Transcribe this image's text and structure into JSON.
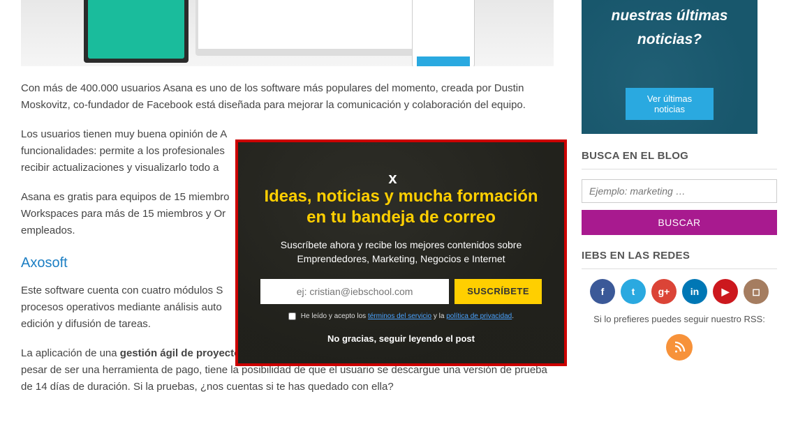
{
  "article": {
    "p1": "Con más de 400.000 usuarios Asana es uno de los software más populares del momento,  creada por Dustin Moskovitz, co-fundador de Facebook está diseñada para mejorar la comunicación y colaboración del equipo.",
    "p2": "Los usuarios tienen muy buena opinión de A",
    "p2b": "funcionalidades: permite a los profesionales",
    "p2c": "recibir actualizaciones y visualizarlo todo a",
    "p3a": "Asana es gratis para equipos de 15 miembro",
    "p3b": "Workspaces para más de 15 miembros y Or",
    "p3c": "empleados.",
    "h_axo": "Axosoft",
    "p4a": "Este software cuenta con cuatro módulos  S",
    "p4b": "procesos operativos mediante análisis auto",
    "p4c": "edición y difusión de tareas.",
    "p5_pre": "La aplicación de una ",
    "p5_bold": "gestión ágil de proyectos",
    "p5_post": " es sencillo a través de todas las posibilidades que nos oferta, a pesar de ser una herramienta de pago, tiene la posibilidad de que el usuario se descargue una versión de prueba de 14 días de duración. Si la pruebas, ¿nos cuentas si te has quedado con ella?"
  },
  "sidebar": {
    "news_q": "nuestras últimas noticias?",
    "news_btn": "Ver últimas noticias",
    "search_h": "BUSCA EN EL BLOG",
    "search_ph": "Ejemplo: marketing …",
    "search_btn": "BUSCAR",
    "social_h": "IEBS EN LAS REDES",
    "rss_txt": "Si lo prefieres puedes seguir nuestro RSS:"
  },
  "modal": {
    "title": "Ideas, noticias y mucha formación en tu bandeja de correo",
    "desc": "Suscríbete ahora y recibe los mejores contenidos sobre Emprendedores, Marketing, Negocios e Internet",
    "email_ph": "ej: cristian@iebschool.com",
    "subscribe": "SUSCRÍBETE",
    "terms_pre": " He leído y acepto los ",
    "terms_link1": "términos del servicio",
    "terms_mid": " y la ",
    "terms_link2": "política de privacidad",
    "terms_post": ".",
    "no_thanks": "No gracias, seguir leyendo el post",
    "close": "x"
  },
  "social_glyphs": {
    "fb": "f",
    "tw": "t",
    "gp": "g+",
    "li": "in",
    "yt": "▶",
    "ig": "◻"
  }
}
